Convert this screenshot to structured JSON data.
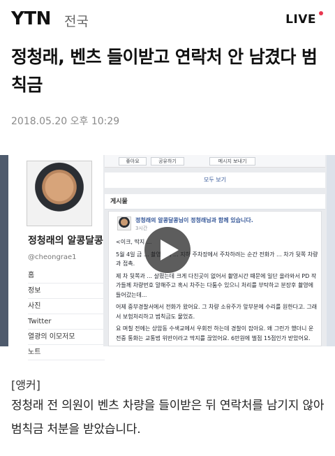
{
  "header": {
    "logo": "YTN",
    "section": "전국",
    "live_label": "LIVE",
    "live_dot_color": "#e8374f"
  },
  "article": {
    "headline": "정청래, 벤츠 들이받고 연락처 안 남겼다 범칙금",
    "date": "2018.05.20 오후 10:29",
    "anchor_tag": "[앵커]",
    "body": "정청래 전 의원이 벤츠 차량을 들이받은 뒤 연락처를 남기지 않아 범칙금 처분을 받았습니다."
  },
  "media": {
    "play_icon": "play-icon",
    "facebook": {
      "profile_name": "정청래의 알콩달콩",
      "profile_handle": "@cheongrae1",
      "nav": [
        "홈",
        "정보",
        "사진",
        "Twitter",
        "열광의 이모저모",
        "노트"
      ],
      "toolbar": [
        "좋아요",
        "공유하기",
        "메시지 보내기"
      ],
      "see_all": "모두 보기",
      "feed_header": "게시물",
      "post": {
        "author": "정청래의 알콩달콩님이 정청래님과 함께 있습니다.",
        "time": "3시간",
        "lines": [
          "<이크, 딱지 ...",
          "5월 4일 금 ... 촬영하러 ... 지하 주차장에서 주차하려는 순간 전화가 ... 차가 뒷쪽 차량과 접촉.",
          "제 차 뒷쪽과 ... 살폈는데 크게 다친곳이 없어서 촬영시간 때문에 일단 올라와서 PD 작가들께 차량번호 말해주고 혹시 차주는 다툼수 있으니 처리를 부탁하고 분장후 촬영에 들어갔는데...",
          "어제 중부경찰서에서 전화가 왔어요. 그 차량 소유주가 앞부분에 수리를 원한다고. 그래서 보험처리하고 범칙금도 물었죠.",
          "요 며칠 전에는 상암동 수색교에서 우회전 하는데 경찰이 잡아요. 왜 그런가 했더니 운전중 통화는 교통법 위반이라고 딱지를 끊었어요. 6만원에 벌점 15점인가 받았어요."
        ]
      }
    }
  }
}
